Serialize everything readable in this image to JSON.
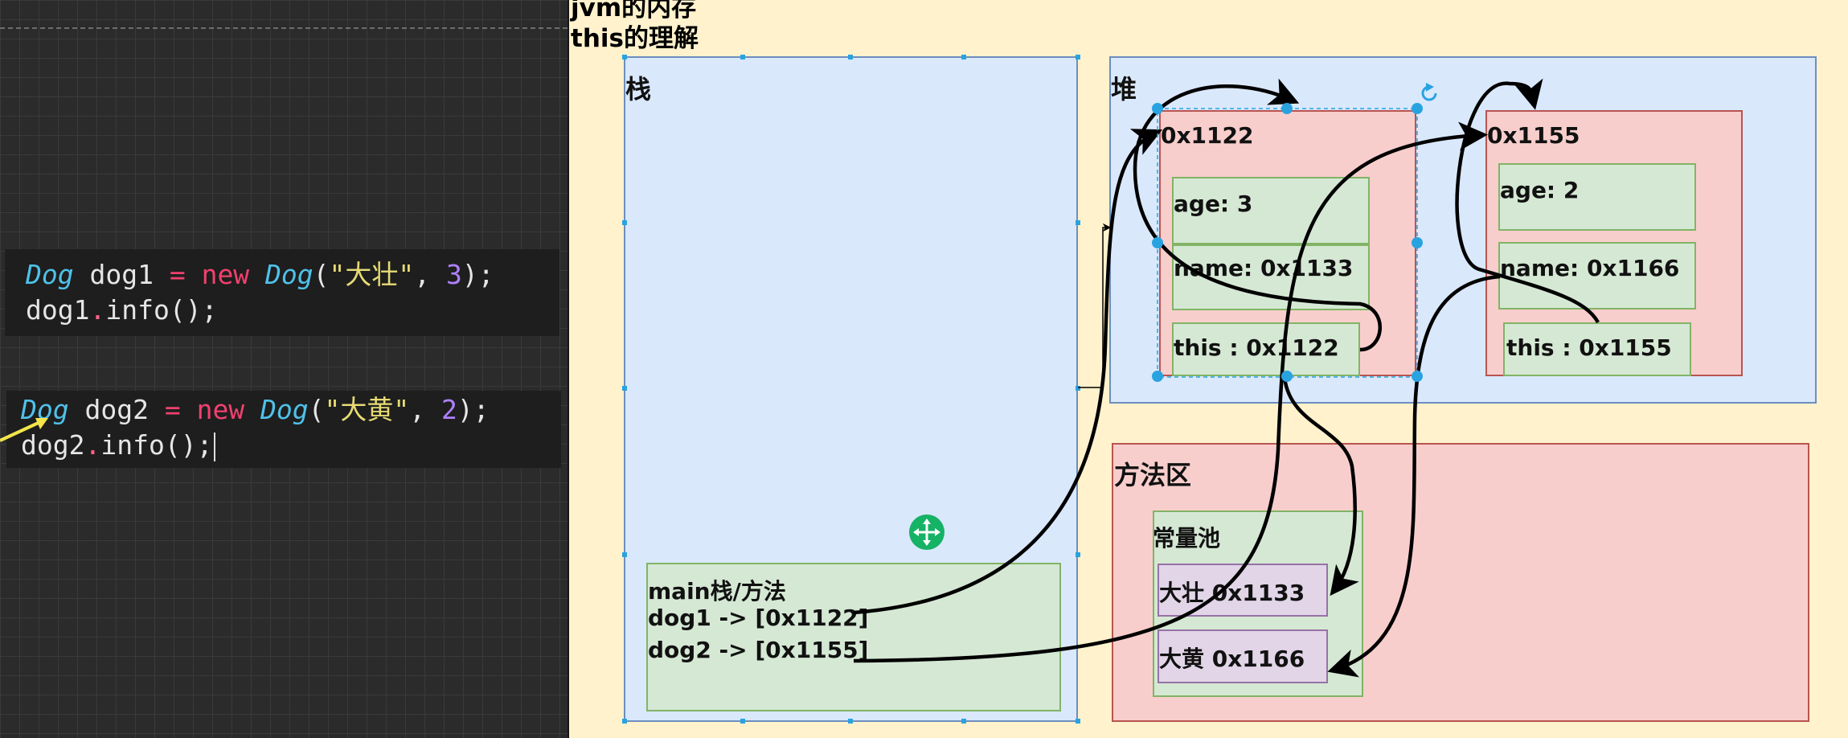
{
  "title": {
    "line1": "jvm的内存",
    "line2": "this的理解"
  },
  "code": {
    "block1": {
      "line1": {
        "type": "Dog",
        "var": " dog1 ",
        "eq": "=",
        "kw": " new ",
        "ctor": "Dog",
        "open": "(",
        "str": "\"大壮\"",
        "comma": ", ",
        "num": "3",
        "close": ");"
      },
      "line2": {
        "obj": "dog1",
        "dot": ".",
        "call": "info();"
      }
    },
    "block2": {
      "line1": {
        "type": "Dog",
        "var": " dog2 ",
        "eq": "=",
        "kw": " new ",
        "ctor": "Dog",
        "open": "(",
        "str": "\"大黄\"",
        "comma": ", ",
        "num": "2",
        "close": ");"
      },
      "line2": {
        "obj": "dog2",
        "dot": ".",
        "call": "info();"
      }
    }
  },
  "stack": {
    "label": "栈",
    "main_frame": {
      "title": "main栈/方法",
      "dog1": "dog1 -> [0x1122]",
      "dog2": "dog2 -> [0x1155]"
    }
  },
  "heap": {
    "label": "堆",
    "objects": [
      {
        "address": "0x1122",
        "age": "age: 3",
        "name": "name: 0x1133",
        "this": "this : 0x1122"
      },
      {
        "address": "0x1155",
        "age": "age: 2",
        "name": "name: 0x1166",
        "this": "this : 0x1155"
      }
    ]
  },
  "method_area": {
    "label": "方法区",
    "constant_pool": {
      "label": "常量池",
      "strings": [
        "大壮 0x1133",
        "大黄 0x1166"
      ]
    }
  },
  "icons": {
    "move": "move-icon",
    "rotate": "rotate-icon"
  },
  "colors": {
    "diagram_background": "#fff2cc",
    "memory_blue": "#dae8fc",
    "object_red": "#f8cecc",
    "field_green": "#d5e8d4",
    "string_purple": "#e1d5e7",
    "selection_handle": "#29a3e0",
    "move_handle": "#16b266"
  }
}
